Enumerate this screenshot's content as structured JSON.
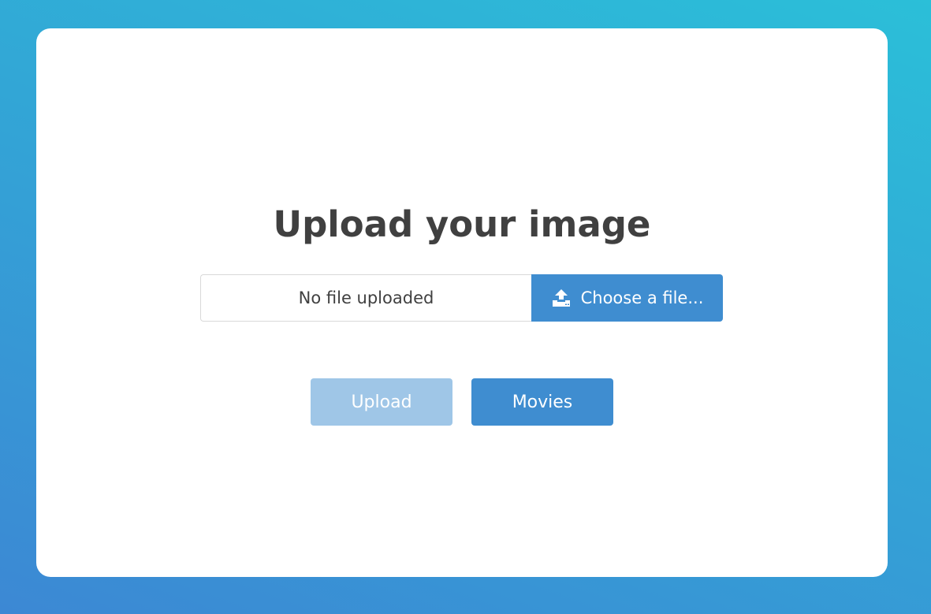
{
  "page": {
    "title": "Upload your image"
  },
  "file_picker": {
    "status": "No file uploaded",
    "choose_label": "Choose a file...",
    "icon": "upload-icon"
  },
  "actions": {
    "upload_label": "Upload",
    "upload_disabled": true,
    "movies_label": "Movies"
  },
  "colors": {
    "primary": "#3f8dd0",
    "primary_disabled": "#9fc6e7",
    "title_text": "#404040",
    "background_top": "#2bbfd8",
    "background_bottom": "#3c88d4"
  }
}
